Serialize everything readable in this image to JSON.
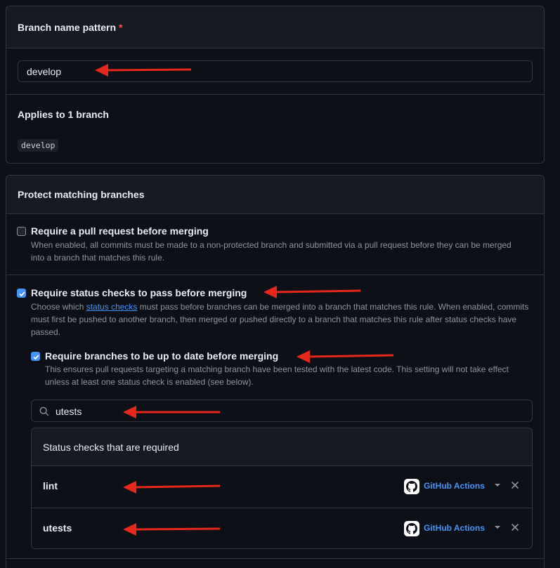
{
  "pattern": {
    "label": "Branch name pattern",
    "required_marker": "*",
    "value": "develop"
  },
  "applies": {
    "title": "Applies to 1 branch",
    "branches": [
      "develop"
    ]
  },
  "protect": {
    "title": "Protect matching branches",
    "pull_request": {
      "checked": false,
      "title": "Require a pull request before merging",
      "description": "When enabled, all commits must be made to a non-protected branch and submitted via a pull request before they can be merged into a branch that matches this rule."
    },
    "status_checks": {
      "checked": true,
      "title": "Require status checks to pass before merging",
      "desc_before": "Choose which ",
      "desc_link": "status checks",
      "desc_after": " must pass before branches can be merged into a branch that matches this rule. When enabled, commits must first be pushed to another branch, then merged or pushed directly to a branch that matches this rule after status checks have passed."
    },
    "up_to_date": {
      "checked": true,
      "title": "Require branches to be up to date before merging",
      "description": "This ensures pull requests targeting a matching branch have been tested with the latest code. This setting will not take effect unless at least one status check is enabled (see below)."
    },
    "search": {
      "value": "utests"
    },
    "required_checks": {
      "title": "Status checks that are required",
      "items": [
        {
          "name": "lint",
          "app": "GitHub Actions"
        },
        {
          "name": "utests",
          "app": "GitHub Actions"
        }
      ]
    }
  },
  "colors": {
    "background": "#0d1117",
    "accent": "#4493f8",
    "annotation_arrow": "#e5281b"
  },
  "icons": [
    "search-icon",
    "github-logo-icon",
    "chevron-down-icon",
    "close-icon",
    "check-icon"
  ]
}
